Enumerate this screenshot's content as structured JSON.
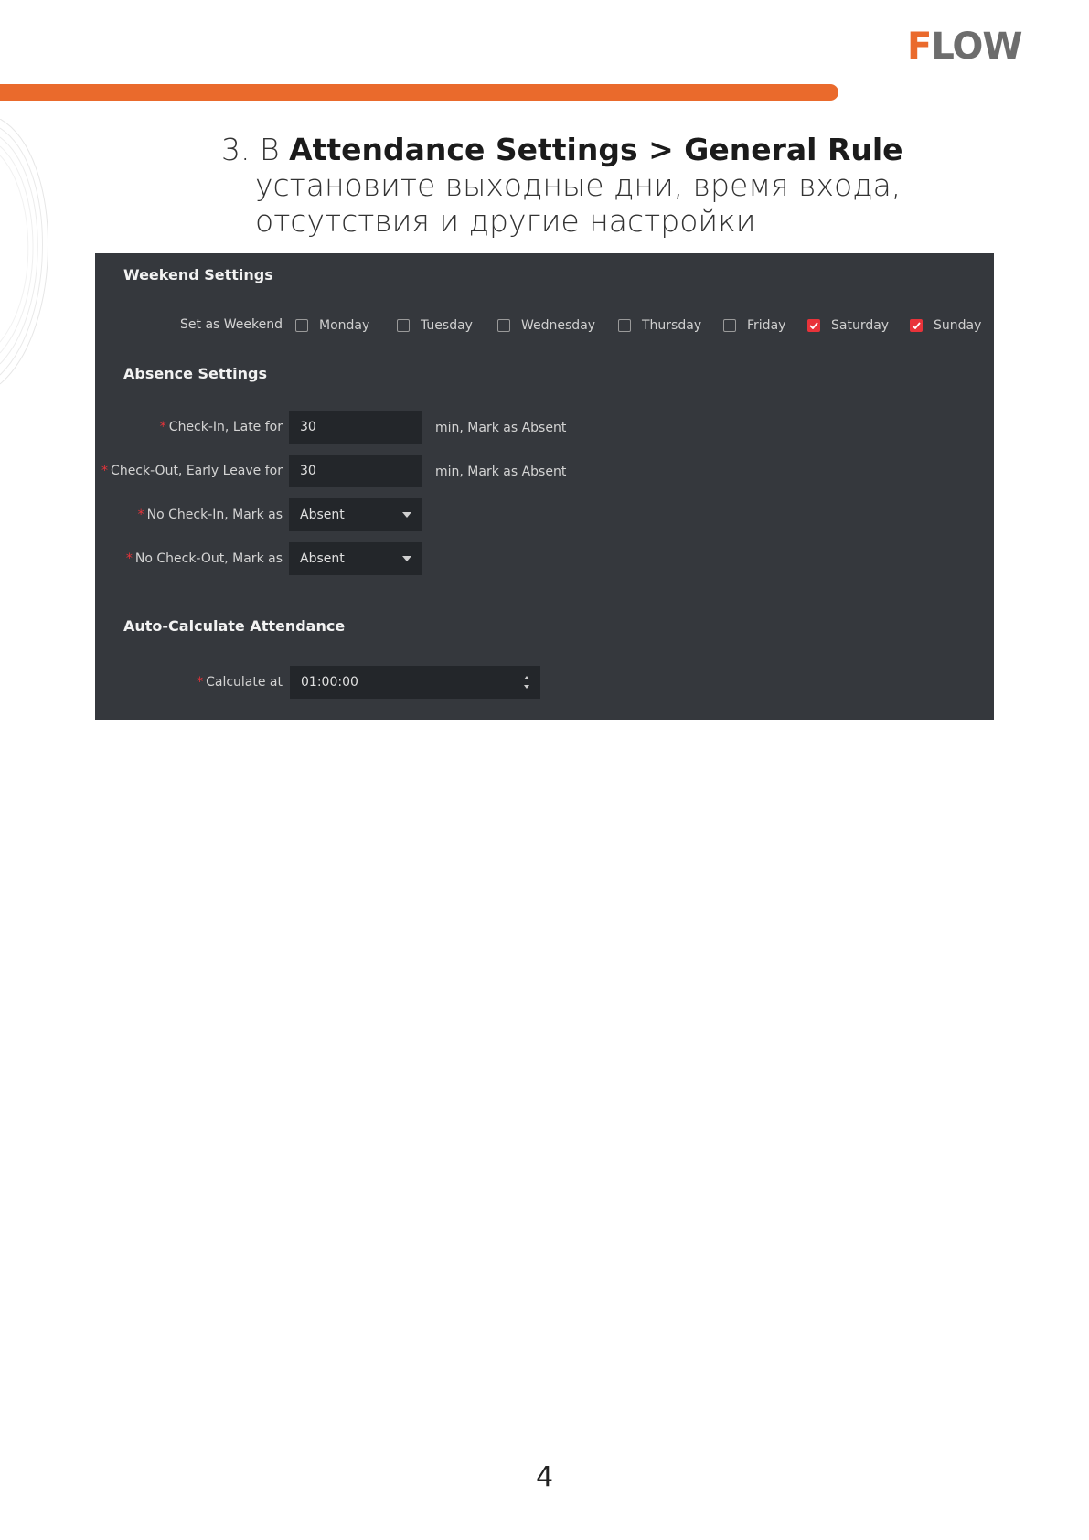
{
  "brand": {
    "logo_first": "F",
    "logo_rest": "LOW",
    "accent": "#ea6a2c"
  },
  "instruction": {
    "number": "3. В ",
    "bold": "Attendance Settings > General Rule",
    "line2": "установите выходные дни, время входа,",
    "line3": "отсутствия и другие настройки"
  },
  "panel": {
    "weekend_title": "Weekend Settings",
    "set_as_weekend_label": "Set as Weekend",
    "days": [
      {
        "label": "Monday",
        "checked": false
      },
      {
        "label": "Tuesday",
        "checked": false
      },
      {
        "label": "Wednesday",
        "checked": false
      },
      {
        "label": "Thursday",
        "checked": false
      },
      {
        "label": "Friday",
        "checked": false
      },
      {
        "label": "Saturday",
        "checked": true
      },
      {
        "label": "Sunday",
        "checked": true
      }
    ],
    "absence_title": "Absence Settings",
    "required_mark": "*",
    "checkin_late_label": "Check-In, Late for",
    "checkin_late_value": "30",
    "checkin_late_suffix": "min, Mark as Absent",
    "checkout_early_label": "Check-Out, Early Leave for",
    "checkout_early_value": "30",
    "checkout_early_suffix": "min, Mark as Absent",
    "no_checkin_label": "No Check-In, Mark as",
    "no_checkin_value": "Absent",
    "no_checkout_label": "No Check-Out, Mark as",
    "no_checkout_value": "Absent",
    "auto_title": "Auto-Calculate Attendance",
    "calculate_at_label": "Calculate at",
    "calculate_at_value": "01:00:00",
    "check_color": "#e8333a"
  },
  "page_number": "4"
}
